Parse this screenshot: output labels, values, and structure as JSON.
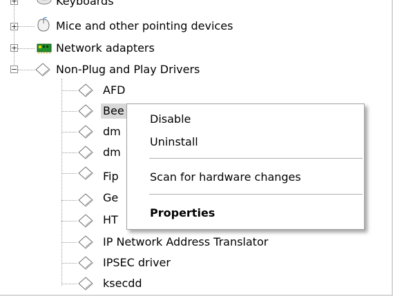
{
  "tree": {
    "categories": [
      {
        "label": "Keyboards",
        "expanded": false,
        "icon": "keyboard-icon"
      },
      {
        "label": "Mice and other pointing devices",
        "expanded": false,
        "icon": "mouse-icon"
      },
      {
        "label": "Network adapters",
        "expanded": false,
        "icon": "network-adapter-icon"
      },
      {
        "label": "Non-Plug and Play Drivers",
        "expanded": true,
        "icon": "driver-diamond-icon"
      }
    ],
    "drivers": [
      {
        "label": "AFD",
        "selected": false
      },
      {
        "label": "Bee",
        "selected": true
      },
      {
        "label": "dm",
        "selected": false
      },
      {
        "label": "dm",
        "selected": false
      },
      {
        "label": "Fip",
        "selected": false
      },
      {
        "label": "Ge",
        "selected": false
      },
      {
        "label": "HT",
        "selected": false
      },
      {
        "label": "IP Network Address Translator",
        "selected": false
      },
      {
        "label": "IPSEC driver",
        "selected": false
      },
      {
        "label": "ksecdd",
        "selected": false
      }
    ]
  },
  "context_menu": {
    "items": [
      {
        "label": "Disable",
        "bold": false
      },
      {
        "label": "Uninstall",
        "bold": false
      },
      {
        "label": "Scan for hardware changes",
        "bold": false
      },
      {
        "label": "Properties",
        "bold": true
      }
    ]
  },
  "colors": {
    "selection": "#d9d9d9",
    "menu_border": "#a0a0a0",
    "diamond_fill": "#ffffff",
    "diamond_stroke": "#6e6e6e",
    "network_green": "#1f8f2c"
  }
}
